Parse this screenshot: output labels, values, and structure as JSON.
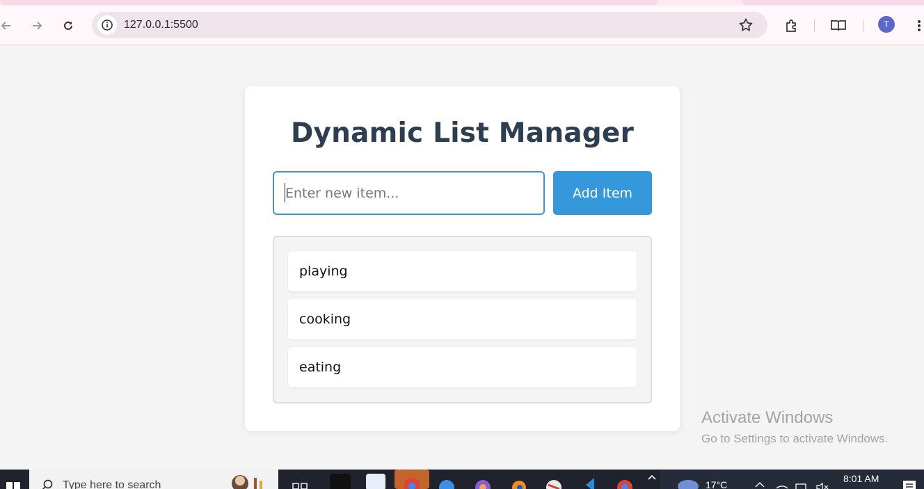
{
  "browser": {
    "url": "127.0.0.1:5500",
    "profile_initial": "T",
    "icons": [
      "back-arrow-icon",
      "forward-arrow-icon",
      "reload-icon",
      "site-info-icon",
      "bookmark-star-icon",
      "extensions-icon",
      "reading-mode-icon",
      "menu-dots-icon"
    ]
  },
  "app": {
    "title": "Dynamic List Manager",
    "input_placeholder": "Enter new item...",
    "input_value": "",
    "add_button_label": "Add Item",
    "items": [
      "playing",
      "cooking",
      "eating"
    ],
    "colors": {
      "accent": "#3498db",
      "title": "#2c3e50"
    }
  },
  "watermark": {
    "line1": "Activate Windows",
    "line2": "Go to Settings to activate Windows."
  },
  "taskbar": {
    "search_placeholder": "Type here to search",
    "weather": "17°C",
    "time": "8:01 AM"
  }
}
